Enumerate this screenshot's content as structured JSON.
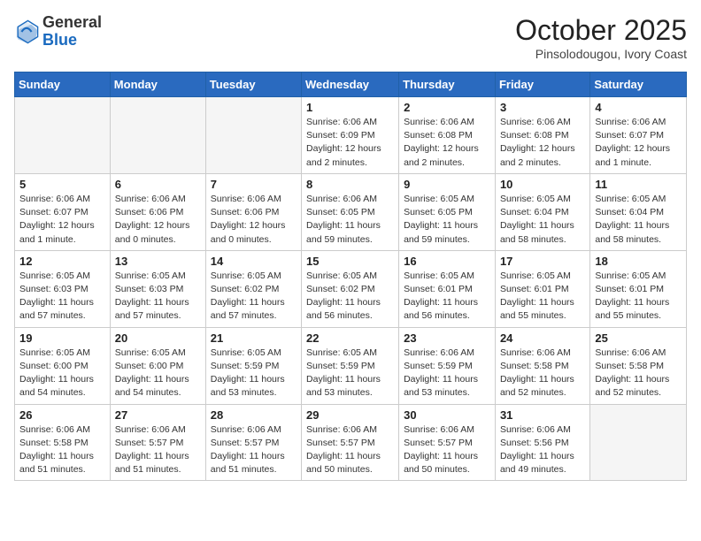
{
  "header": {
    "logo_general": "General",
    "logo_blue": "Blue",
    "month_title": "October 2025",
    "subtitle": "Pinsolodougou, Ivory Coast"
  },
  "weekdays": [
    "Sunday",
    "Monday",
    "Tuesday",
    "Wednesday",
    "Thursday",
    "Friday",
    "Saturday"
  ],
  "weeks": [
    [
      {
        "num": "",
        "info": ""
      },
      {
        "num": "",
        "info": ""
      },
      {
        "num": "",
        "info": ""
      },
      {
        "num": "1",
        "info": "Sunrise: 6:06 AM\nSunset: 6:09 PM\nDaylight: 12 hours\nand 2 minutes."
      },
      {
        "num": "2",
        "info": "Sunrise: 6:06 AM\nSunset: 6:08 PM\nDaylight: 12 hours\nand 2 minutes."
      },
      {
        "num": "3",
        "info": "Sunrise: 6:06 AM\nSunset: 6:08 PM\nDaylight: 12 hours\nand 2 minutes."
      },
      {
        "num": "4",
        "info": "Sunrise: 6:06 AM\nSunset: 6:07 PM\nDaylight: 12 hours\nand 1 minute."
      }
    ],
    [
      {
        "num": "5",
        "info": "Sunrise: 6:06 AM\nSunset: 6:07 PM\nDaylight: 12 hours\nand 1 minute."
      },
      {
        "num": "6",
        "info": "Sunrise: 6:06 AM\nSunset: 6:06 PM\nDaylight: 12 hours\nand 0 minutes."
      },
      {
        "num": "7",
        "info": "Sunrise: 6:06 AM\nSunset: 6:06 PM\nDaylight: 12 hours\nand 0 minutes."
      },
      {
        "num": "8",
        "info": "Sunrise: 6:06 AM\nSunset: 6:05 PM\nDaylight: 11 hours\nand 59 minutes."
      },
      {
        "num": "9",
        "info": "Sunrise: 6:05 AM\nSunset: 6:05 PM\nDaylight: 11 hours\nand 59 minutes."
      },
      {
        "num": "10",
        "info": "Sunrise: 6:05 AM\nSunset: 6:04 PM\nDaylight: 11 hours\nand 58 minutes."
      },
      {
        "num": "11",
        "info": "Sunrise: 6:05 AM\nSunset: 6:04 PM\nDaylight: 11 hours\nand 58 minutes."
      }
    ],
    [
      {
        "num": "12",
        "info": "Sunrise: 6:05 AM\nSunset: 6:03 PM\nDaylight: 11 hours\nand 57 minutes."
      },
      {
        "num": "13",
        "info": "Sunrise: 6:05 AM\nSunset: 6:03 PM\nDaylight: 11 hours\nand 57 minutes."
      },
      {
        "num": "14",
        "info": "Sunrise: 6:05 AM\nSunset: 6:02 PM\nDaylight: 11 hours\nand 57 minutes."
      },
      {
        "num": "15",
        "info": "Sunrise: 6:05 AM\nSunset: 6:02 PM\nDaylight: 11 hours\nand 56 minutes."
      },
      {
        "num": "16",
        "info": "Sunrise: 6:05 AM\nSunset: 6:01 PM\nDaylight: 11 hours\nand 56 minutes."
      },
      {
        "num": "17",
        "info": "Sunrise: 6:05 AM\nSunset: 6:01 PM\nDaylight: 11 hours\nand 55 minutes."
      },
      {
        "num": "18",
        "info": "Sunrise: 6:05 AM\nSunset: 6:01 PM\nDaylight: 11 hours\nand 55 minutes."
      }
    ],
    [
      {
        "num": "19",
        "info": "Sunrise: 6:05 AM\nSunset: 6:00 PM\nDaylight: 11 hours\nand 54 minutes."
      },
      {
        "num": "20",
        "info": "Sunrise: 6:05 AM\nSunset: 6:00 PM\nDaylight: 11 hours\nand 54 minutes."
      },
      {
        "num": "21",
        "info": "Sunrise: 6:05 AM\nSunset: 5:59 PM\nDaylight: 11 hours\nand 53 minutes."
      },
      {
        "num": "22",
        "info": "Sunrise: 6:05 AM\nSunset: 5:59 PM\nDaylight: 11 hours\nand 53 minutes."
      },
      {
        "num": "23",
        "info": "Sunrise: 6:06 AM\nSunset: 5:59 PM\nDaylight: 11 hours\nand 53 minutes."
      },
      {
        "num": "24",
        "info": "Sunrise: 6:06 AM\nSunset: 5:58 PM\nDaylight: 11 hours\nand 52 minutes."
      },
      {
        "num": "25",
        "info": "Sunrise: 6:06 AM\nSunset: 5:58 PM\nDaylight: 11 hours\nand 52 minutes."
      }
    ],
    [
      {
        "num": "26",
        "info": "Sunrise: 6:06 AM\nSunset: 5:58 PM\nDaylight: 11 hours\nand 51 minutes."
      },
      {
        "num": "27",
        "info": "Sunrise: 6:06 AM\nSunset: 5:57 PM\nDaylight: 11 hours\nand 51 minutes."
      },
      {
        "num": "28",
        "info": "Sunrise: 6:06 AM\nSunset: 5:57 PM\nDaylight: 11 hours\nand 51 minutes."
      },
      {
        "num": "29",
        "info": "Sunrise: 6:06 AM\nSunset: 5:57 PM\nDaylight: 11 hours\nand 50 minutes."
      },
      {
        "num": "30",
        "info": "Sunrise: 6:06 AM\nSunset: 5:57 PM\nDaylight: 11 hours\nand 50 minutes."
      },
      {
        "num": "31",
        "info": "Sunrise: 6:06 AM\nSunset: 5:56 PM\nDaylight: 11 hours\nand 49 minutes."
      },
      {
        "num": "",
        "info": ""
      }
    ]
  ]
}
